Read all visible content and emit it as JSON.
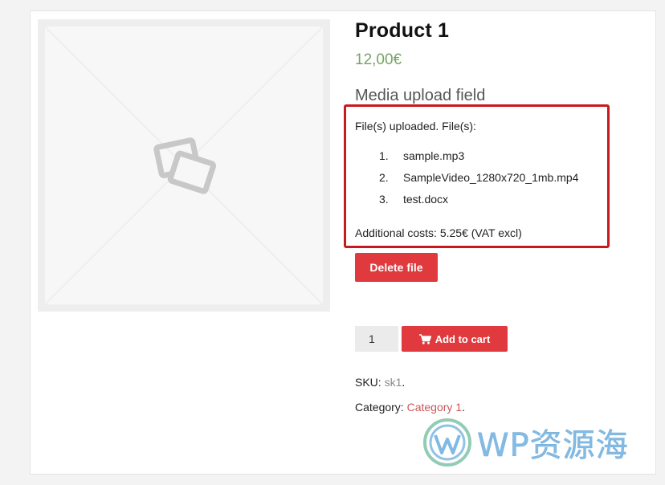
{
  "product": {
    "title": "Product 1",
    "price": "12,00€"
  },
  "media_field": {
    "heading": "Media upload field",
    "uploaded_text": "File(s) uploaded. File(s):",
    "files": [
      {
        "num": "1.",
        "name": "sample.mp3"
      },
      {
        "num": "2.",
        "name": "SampleVideo_1280x720_1mb.mp4"
      },
      {
        "num": "3.",
        "name": "test.docx"
      }
    ],
    "additional_costs": "Additional costs: 5.25€ (VAT excl)",
    "highlight_color": "#c9181e"
  },
  "actions": {
    "delete_label": "Delete file",
    "quantity_value": "1",
    "add_to_cart_label": "Add to cart",
    "button_color": "#e0393e"
  },
  "meta": {
    "sku_label": "SKU:",
    "sku_value": "sk1",
    "sku_suffix": ".",
    "category_label": "Category:",
    "category_value": "Category 1",
    "category_suffix": "."
  },
  "watermark": {
    "text": "WP资源海"
  },
  "icons": {
    "cart": "shopping-cart-icon",
    "placeholder": "image-placeholder-icon"
  }
}
